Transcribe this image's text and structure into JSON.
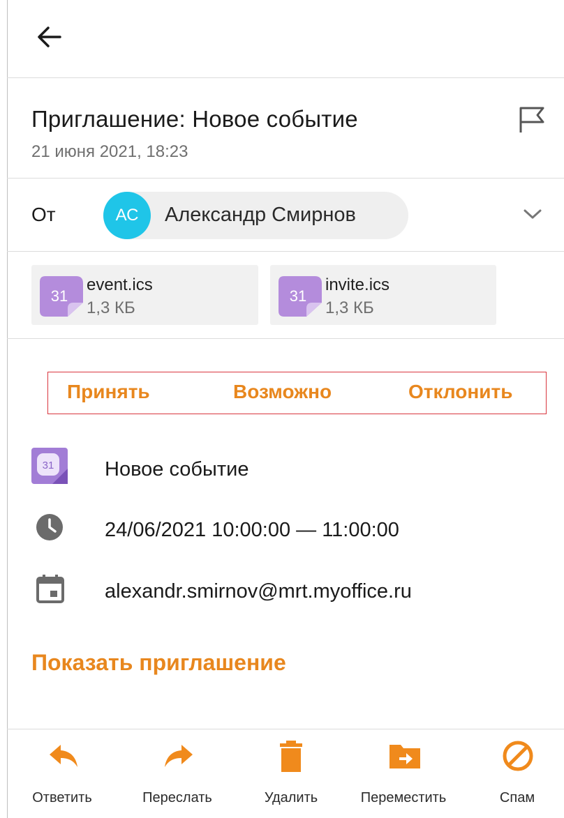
{
  "header": {
    "back_icon": "arrow-left-icon"
  },
  "message": {
    "subject": "Приглашение: Новое событие",
    "date": "21 июня 2021, 18:23",
    "flag_icon": "flag-icon",
    "from_label": "От",
    "sender": {
      "initials": "АС",
      "name": "Александр Смирнов",
      "avatar_color": "#1fc5e8"
    },
    "attachments": [
      {
        "name": "event.ics",
        "size": "1,3 КБ",
        "badge": "31",
        "icon": "calendar-file-icon"
      },
      {
        "name": "invite.ics",
        "size": "1,3 КБ",
        "badge": "31",
        "icon": "calendar-file-icon"
      }
    ]
  },
  "rsvp": {
    "accept": "Принять",
    "maybe": "Возможно",
    "decline": "Отклонить"
  },
  "event": {
    "title": "Новое событие",
    "calendar_badge": "31",
    "time": "24/06/2021 10:00:00 — 11:00:00",
    "calendar": "alexandr.smirnov@mrt.myoffice.ru"
  },
  "show_invitation": "Показать приглашение",
  "toolbar": [
    {
      "label": "Ответить",
      "icon": "reply-icon"
    },
    {
      "label": "Переслать",
      "icon": "forward-icon"
    },
    {
      "label": "Удалить",
      "icon": "trash-icon"
    },
    {
      "label": "Переместить",
      "icon": "move-folder-icon"
    },
    {
      "label": "Спам",
      "icon": "spam-icon"
    }
  ],
  "colors": {
    "accent": "#e8871e",
    "highlight_border": "#d9363e",
    "avatar": "#1fc5e8",
    "file_icon": "#b48cdc"
  }
}
